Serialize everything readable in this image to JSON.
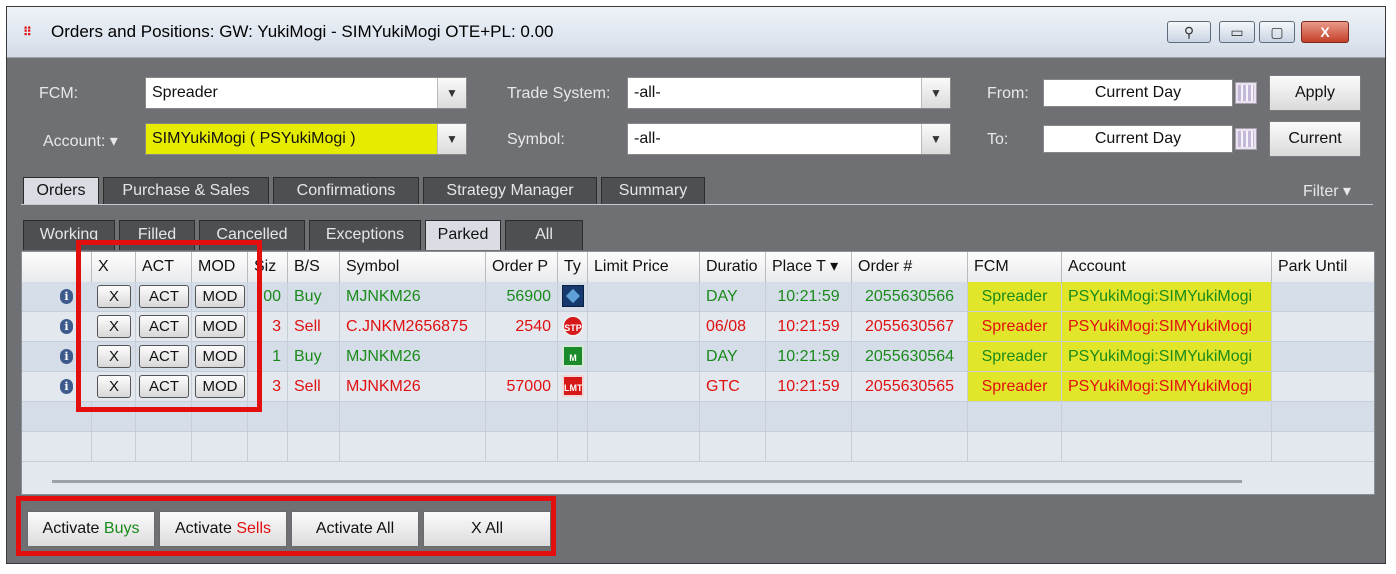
{
  "window": {
    "title": "Orders and Positions: GW: YukiMogi - SIMYukiMogi OTE+PL: 0.00",
    "controls": {
      "restore_glyph": "▭",
      "maximize_glyph": "▢",
      "close_glyph": "X"
    }
  },
  "filters": {
    "fcm_label": "FCM:",
    "fcm_value": "Spreader",
    "account_label": "Account: ▾",
    "account_value": "SIMYukiMogi ( PSYukiMogi )",
    "trade_system_label": "Trade System:",
    "trade_system_value": "-all-",
    "symbol_label": "Symbol:",
    "symbol_value": "-all-",
    "from_label": "From:",
    "from_value": "Current Day",
    "to_label": "To:",
    "to_value": "Current Day",
    "apply_label": "Apply",
    "current_label": "Current"
  },
  "main_tabs": [
    "Orders",
    "Purchase & Sales",
    "Confirmations",
    "Strategy Manager",
    "Summary"
  ],
  "filter_menu_label": "Filter ▾",
  "sub_tabs": [
    "Working",
    "Filled",
    "Cancelled",
    "Exceptions",
    "Parked",
    "All"
  ],
  "table": {
    "columns": [
      "X",
      "ACT",
      "MOD",
      "Siz",
      "B/S",
      "Symbol",
      "Order P",
      "Ty",
      "Limit Price",
      "Duratio",
      "Place T ▾",
      "Order #",
      "FCM",
      "Account",
      "Park Until"
    ],
    "button_labels": {
      "x": "X",
      "act": "ACT",
      "mod": "MOD"
    },
    "rows": [
      {
        "size": "00",
        "side": "Buy",
        "symbol": "MJNKM26",
        "order_price": "56900",
        "type_icon": "diamond-icon",
        "limit_price": "",
        "duration": "DAY",
        "place_time": "10:21:59",
        "order_num": "2055630566",
        "fcm": "Spreader",
        "account": "PSYukiMogi:SIMYukiMogi",
        "park_until": "",
        "color": "green"
      },
      {
        "size": "3",
        "side": "Sell",
        "symbol": "C.JNKM2656875",
        "order_price": "2540",
        "type_icon": "stop-icon",
        "type_text": "STP",
        "limit_price": "",
        "duration": "06/08",
        "place_time": "10:21:59",
        "order_num": "2055630567",
        "fcm": "Spreader",
        "account": "PSYukiMogi:SIMYukiMogi",
        "park_until": "",
        "color": "red"
      },
      {
        "size": "1",
        "side": "Buy",
        "symbol": "MJNKM26",
        "order_price": "",
        "type_icon": "market-icon",
        "type_text": "M",
        "limit_price": "",
        "duration": "DAY",
        "place_time": "10:21:59",
        "order_num": "2055630564",
        "fcm": "Spreader",
        "account": "PSYukiMogi:SIMYukiMogi",
        "park_until": "",
        "color": "green"
      },
      {
        "size": "3",
        "side": "Sell",
        "symbol": "MJNKM26",
        "order_price": "57000",
        "type_icon": "limit-icon",
        "type_text": "LMT",
        "limit_price": "",
        "duration": "GTC",
        "place_time": "10:21:59",
        "order_num": "2055630565",
        "fcm": "Spreader",
        "account": "PSYukiMogi:SIMYukiMogi",
        "park_until": "",
        "color": "red"
      }
    ]
  },
  "bottom": {
    "activate_buys_prefix": "Activate ",
    "activate_buys_word": "Buys",
    "activate_sells_prefix": "Activate ",
    "activate_sells_word": "Sells",
    "activate_all": "Activate All",
    "x_all": "X All"
  },
  "colors": {
    "buy": "#1a8a1a",
    "sell": "#e01010",
    "highlight": "#e30f0f",
    "account_yellow": "#e2e62a"
  }
}
